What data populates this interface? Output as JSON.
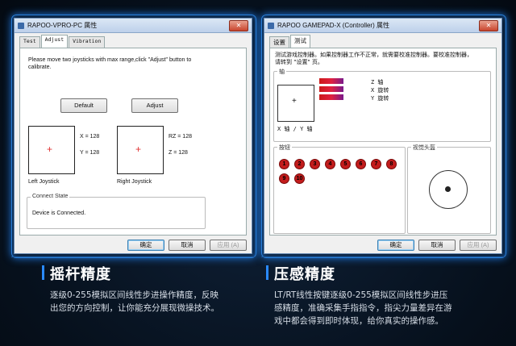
{
  "left_window": {
    "title": "RAPOO-VPRO-PC 属性",
    "tabs": [
      "Test",
      "Adjust",
      "Vibration"
    ],
    "instructions": "Please move two joysticks with max range,click \"Adjust\" button to calibrate.",
    "default_label": "Default",
    "adjust_label": "Adjust",
    "left_x": "X = 128",
    "left_y": "Y = 128",
    "right_rz": "RZ = 128",
    "right_z": "Z = 128",
    "left_caption": "Left Joystick",
    "right_caption": "Right Joystick",
    "connect_title": "Connect State",
    "connect_status": "Device is Connected.",
    "ok": "确定",
    "cancel": "取消",
    "apply": "应用 (A)"
  },
  "right_window": {
    "title": "RAPOO GAMEPAD-X (Controller) 属性",
    "tabs": [
      "设置",
      "测试"
    ],
    "intro": "测试游戏控制器。如果控制器工作不正常，就需要校准控制器。要校准控制器，请转到 \"设置\" 页。",
    "axis_group": "轴",
    "z_axis": "Z 轴",
    "x_rotation": "X 旋转",
    "y_rotation": "Y 旋转",
    "xy_axis": "X 轴 / Y 轴",
    "buttons_group": "按钮",
    "buttons": [
      "1",
      "2",
      "3",
      "4",
      "5",
      "6",
      "7",
      "8",
      "9",
      "10"
    ],
    "pov_group": "视觉头盔",
    "ok": "确定",
    "cancel": "取消",
    "apply": "应用 (A)"
  },
  "captions": {
    "left_title": "摇杆精度",
    "left_body_1": "逐级0-255模拟区间线性步进操作精度，反映",
    "left_body_2": "出您的方向控制，让你能充分展现微操技术。",
    "right_title": "压感精度",
    "right_body_1": "LT/RT线性按键逐级0-255模拟区间线性步进压",
    "right_body_2": "感精度，准确采集手指指令，指尖力量差异在游",
    "right_body_3": "戏中都会得到即时体现，给你真实的操作感。"
  },
  "colors": {
    "accent": "#2a8aff",
    "indicator": "#cc1a1a"
  }
}
